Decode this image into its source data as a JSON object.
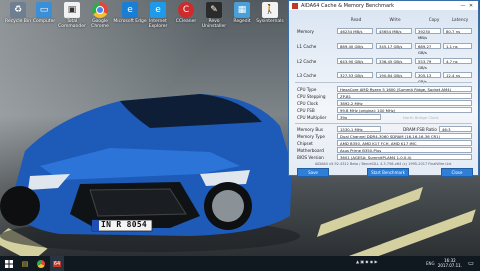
{
  "desktop_icons": [
    {
      "label": "Recycle Bin",
      "icon": "recycle-bin-icon",
      "color": "#6e7f91"
    },
    {
      "label": "Computer",
      "icon": "computer-icon",
      "color": "#3b8fd6"
    },
    {
      "label": "Total Commander",
      "icon": "floppy-icon",
      "color": "#f2f2f2"
    },
    {
      "label": "Google Chrome",
      "icon": "chrome-icon",
      "color": "#e4463b"
    },
    {
      "label": "Microsoft Edge",
      "icon": "edge-icon",
      "color": "#1a7fd4"
    },
    {
      "label": "Internet Explorer",
      "icon": "ie-icon",
      "color": "#1e9be8"
    },
    {
      "label": "CCleaner",
      "icon": "ccleaner-icon",
      "color": "#cf2b2b"
    },
    {
      "label": "Revo Uninstaller",
      "icon": "revo-icon",
      "color": "#2b2b2b"
    },
    {
      "label": "Regedit",
      "icon": "registry-icon",
      "color": "#49a0d9"
    },
    {
      "label": "Sysinternals",
      "icon": "person-icon",
      "color": "#f2f2f2"
    }
  ],
  "car_plate": "IN R 8054",
  "aida": {
    "title": "AIDA64 Cache & Memory Benchmark",
    "headers": [
      "Read",
      "Write",
      "Copy",
      "Latency"
    ],
    "rows": [
      {
        "label": "Memory",
        "values": [
          "46234 MB/s",
          "45654 MB/s",
          "39230 MB/s",
          "80.7 ns"
        ]
      },
      {
        "label": "L1 Cache",
        "values": [
          "889.40 GB/s",
          "345.17 GB/s",
          "689.27 GB/s",
          "1.1 ns"
        ]
      },
      {
        "label": "L2 Cache",
        "values": [
          "643.90 GB/s",
          "336.45 GB/s",
          "553.79 GB/s",
          "4.7 ns"
        ]
      },
      {
        "label": "L3 Cache",
        "values": [
          "327.53 GB/s",
          "190.84 GB/s",
          "305.13 GB/s",
          "12.4 ns"
        ]
      }
    ],
    "info": [
      {
        "label": "CPU Type",
        "value": "HexaCore AMD Ryzen 5 1600  (Summit Ridge, Socket AM4)"
      },
      {
        "label": "CPU Stepping",
        "value": "ZP-B1"
      },
      {
        "label": "CPU Clock",
        "value": "3892.2 MHz"
      },
      {
        "label": "CPU FSB",
        "value": "99.8 MHz  (original: 100 MHz)"
      },
      {
        "label": "CPU Multiplier",
        "value": "39x"
      }
    ],
    "nb_clock_label": "North Bridge Clock",
    "mem": {
      "bus_label": "Memory Bus",
      "bus_value": "1530.1 MHz",
      "ratio_label": "DRAM:FSB Ratio",
      "ratio_value": "46:3",
      "type_label": "Memory Type",
      "type_value": "Dual Channel DDR4-3060 SDRAM  (16-16-16-36 CR1)",
      "chipset_label": "Chipset",
      "chipset_value": "AMD B350, AMD K17 FCH, AMD K17 IMC",
      "mobo_label": "Motherboard",
      "mobo_value": "Asus Prime B350-Plus",
      "bios_label": "BIOS Version",
      "bios_value": "3601  (AGESA: SummitPI-AM4 1.0.0.4)"
    },
    "footer": "AIDA64 v5.92.4312 Beta / BenchDLL 4.3.756-x64  (c) 1995-2017 FinalWire Ltd.",
    "buttons": {
      "save": "Save",
      "start": "Start Benchmark",
      "close": "Close"
    }
  },
  "taskbar": {
    "clock_time": "16:32",
    "clock_date": "2017.07.11.",
    "lang": "ENG",
    "aida_badge": "64"
  }
}
